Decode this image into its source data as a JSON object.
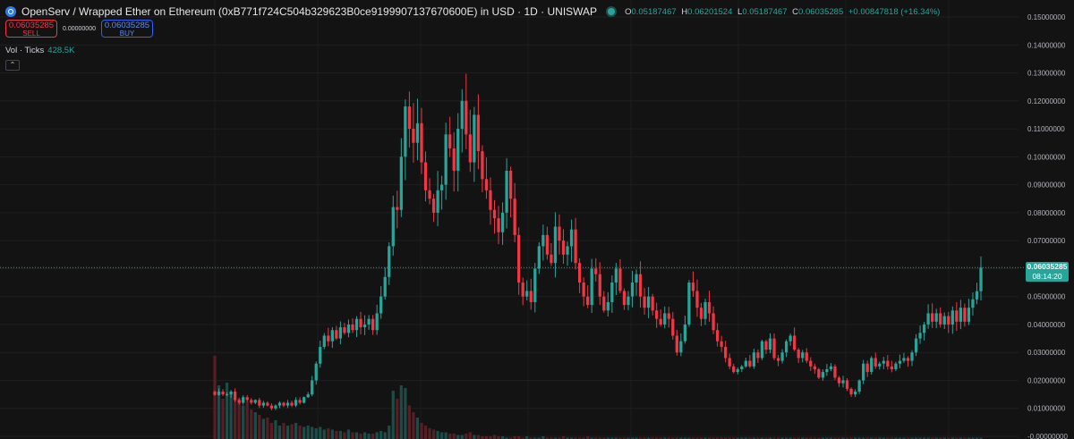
{
  "header": {
    "title": "OpenServ / Wrapped Ether on Ethereum (0xB771f724C504b329623B0ce9199907137670600E) in USD · 1D · UNISWAP",
    "ohlc": {
      "o_label": "O",
      "o_value": "0.05187467",
      "h_label": "H",
      "h_value": "0.06201524",
      "l_label": "L",
      "l_value": "0.05187467",
      "c_label": "C",
      "c_value": "0.06035285",
      "change": "+0.00847818 (+16.34%)"
    },
    "colors": {
      "up": "#26a69a",
      "down": "#f23645",
      "buy": "#2962ff",
      "background": "#131313"
    }
  },
  "trade": {
    "sell_price": "0.06035285",
    "sell_label": "SELL",
    "spread": "0.00000000",
    "buy_price": "0.06035285",
    "buy_label": "BUY"
  },
  "volume": {
    "label": "Vol · Ticks",
    "value": "428.5K"
  },
  "price_label": {
    "price": "0.06035285",
    "countdown": "08:14:20"
  },
  "chart_data": {
    "type": "candlestick",
    "y_axis_labels": [
      "0.15000000",
      "0.14000000",
      "0.13000000",
      "0.12000000",
      "0.11000000",
      "0.10000000",
      "0.09000000",
      "0.08000000",
      "0.07000000",
      "0.06000000",
      "0.05000000",
      "0.04000000",
      "0.03000000",
      "0.02000000",
      "0.01000000",
      "-0.00000000"
    ],
    "ylim": [
      0,
      0.15
    ],
    "grid": true,
    "last_price": 0.06035285,
    "closes": [
      0.0148,
      0.016,
      0.015,
      0.015,
      0.016,
      0.013,
      0.012,
      0.014,
      0.013,
      0.012,
      0.013,
      0.011,
      0.012,
      0.011,
      0.01,
      0.011,
      0.012,
      0.011,
      0.012,
      0.011,
      0.013,
      0.012,
      0.014,
      0.015,
      0.02,
      0.026,
      0.032,
      0.036,
      0.034,
      0.038,
      0.035,
      0.039,
      0.037,
      0.04,
      0.038,
      0.042,
      0.039,
      0.04,
      0.042,
      0.038,
      0.044,
      0.05,
      0.057,
      0.068,
      0.082,
      0.081,
      0.1,
      0.118,
      0.11,
      0.105,
      0.112,
      0.098,
      0.088,
      0.085,
      0.08,
      0.088,
      0.09,
      0.108,
      0.103,
      0.095,
      0.11,
      0.12,
      0.108,
      0.098,
      0.115,
      0.102,
      0.092,
      0.088,
      0.081,
      0.078,
      0.073,
      0.08,
      0.095,
      0.085,
      0.072,
      0.055,
      0.05,
      0.052,
      0.048,
      0.06,
      0.068,
      0.072,
      0.065,
      0.062,
      0.075,
      0.07,
      0.065,
      0.068,
      0.074,
      0.062,
      0.055,
      0.05,
      0.047,
      0.06,
      0.058,
      0.05,
      0.045,
      0.048,
      0.055,
      0.06,
      0.052,
      0.047,
      0.05,
      0.055,
      0.058,
      0.05,
      0.046,
      0.05,
      0.045,
      0.042,
      0.04,
      0.044,
      0.042,
      0.036,
      0.03,
      0.034,
      0.04,
      0.055,
      0.052,
      0.046,
      0.042,
      0.048,
      0.044,
      0.038,
      0.034,
      0.032,
      0.028,
      0.025,
      0.023,
      0.024,
      0.025,
      0.027,
      0.025,
      0.03,
      0.028,
      0.034,
      0.031,
      0.035,
      0.028,
      0.027,
      0.03,
      0.034,
      0.036,
      0.031,
      0.028,
      0.03,
      0.027,
      0.025,
      0.024,
      0.021,
      0.023,
      0.024,
      0.025,
      0.021,
      0.019,
      0.02,
      0.017,
      0.015,
      0.016,
      0.02,
      0.026,
      0.023,
      0.028,
      0.025,
      0.026,
      0.027,
      0.025,
      0.024,
      0.026,
      0.027,
      0.028,
      0.027,
      0.03,
      0.035,
      0.037,
      0.04,
      0.044,
      0.041,
      0.044,
      0.04,
      0.043,
      0.04,
      0.045,
      0.041,
      0.046,
      0.041,
      0.046,
      0.049,
      0.0519,
      0.06035
    ],
    "volumes": [
      0.62,
      0.4,
      0.3,
      0.42,
      0.35,
      0.3,
      0.3,
      0.25,
      0.28,
      0.22,
      0.2,
      0.18,
      0.15,
      0.16,
      0.12,
      0.14,
      0.1,
      0.12,
      0.1,
      0.11,
      0.12,
      0.1,
      0.09,
      0.1,
      0.09,
      0.08,
      0.09,
      0.07,
      0.08,
      0.07,
      0.06,
      0.06,
      0.05,
      0.07,
      0.05,
      0.05,
      0.04,
      0.05,
      0.04,
      0.04,
      0.05,
      0.06,
      0.05,
      0.1,
      0.36,
      0.3,
      0.4,
      0.38,
      0.25,
      0.2,
      0.16,
      0.12,
      0.1,
      0.08,
      0.07,
      0.06,
      0.05,
      0.05,
      0.04,
      0.04,
      0.03,
      0.03,
      0.04,
      0.05,
      0.03,
      0.03,
      0.02,
      0.02,
      0.02,
      0.03,
      0.02,
      0.02,
      0.01,
      0.01,
      0.02,
      0.02,
      0.01,
      0.02,
      0.01,
      0.01,
      0.01,
      0.02,
      0.01,
      0.01,
      0.01,
      0.01,
      0.02,
      0.01,
      0.01,
      0.01,
      0.01,
      0.01,
      0.02,
      0.01,
      0.01,
      0.01,
      0.01,
      0.01,
      0.01,
      0.01,
      0.01,
      0.01,
      0.01,
      0.01,
      0.01,
      0.01,
      0.01,
      0.01,
      0.01,
      0.01,
      0.01,
      0.01,
      0.01,
      0.01,
      0.01,
      0.01,
      0.01,
      0.01,
      0.01,
      0.01,
      0.01,
      0.01,
      0.01,
      0.01,
      0.01,
      0.01,
      0.01,
      0.01,
      0.01,
      0.01,
      0.01,
      0.01,
      0.01,
      0.01,
      0.01,
      0.01,
      0.01,
      0.01,
      0.01,
      0.01,
      0.01,
      0.01,
      0.01,
      0.01,
      0.01,
      0.01,
      0.01,
      0.01,
      0.01,
      0.01,
      0.01,
      0.01,
      0.01,
      0.01,
      0.01,
      0.01,
      0.01,
      0.01,
      0.01,
      0.01,
      0.01,
      0.01,
      0.01,
      0.01,
      0.01,
      0.01,
      0.01,
      0.01,
      0.01,
      0.01,
      0.01,
      0.01,
      0.01,
      0.01,
      0.01,
      0.01,
      0.01,
      0.01,
      0.01,
      0.01,
      0.01,
      0.01,
      0.01,
      0.01,
      0.01,
      0.01,
      0.01,
      0.01,
      0.01,
      0.01,
      0.01,
      0.01,
      0.01,
      0.01,
      0.01,
      0.01,
      0.01,
      0.01,
      0.01,
      0.01,
      0.01,
      0.01
    ]
  }
}
